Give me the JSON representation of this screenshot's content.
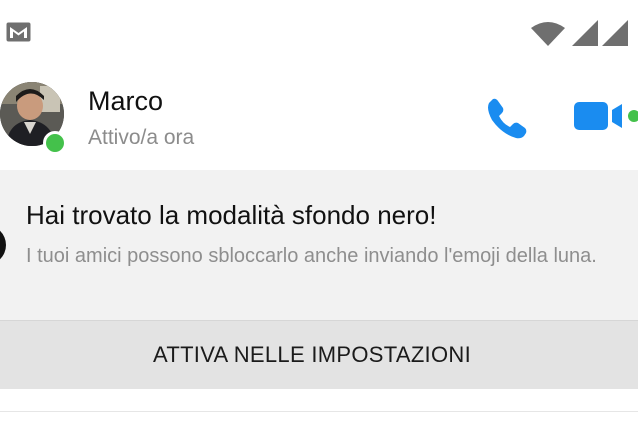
{
  "status_bar": {
    "notification_icon": "gmail-icon",
    "wifi_icon": "wifi-icon",
    "signal_icon": "signal-icon"
  },
  "header": {
    "contact_name": "Marco",
    "contact_status": "Attivo/a ora",
    "avatar_icon": "avatar",
    "presence": "online",
    "call_icon": "phone-icon",
    "video_icon": "video-camera-icon",
    "accent_color": "#1a8cf0",
    "presence_color": "#44c14b"
  },
  "promo": {
    "title": "Hai trovato la modalità sfondo nero!",
    "body": "I tuoi amici possono sbloccarlo anche inviando l'emoji della luna.",
    "action_label": "ATTIVA NELLE IMPOSTAZIONI",
    "icon": "moon-icon"
  }
}
